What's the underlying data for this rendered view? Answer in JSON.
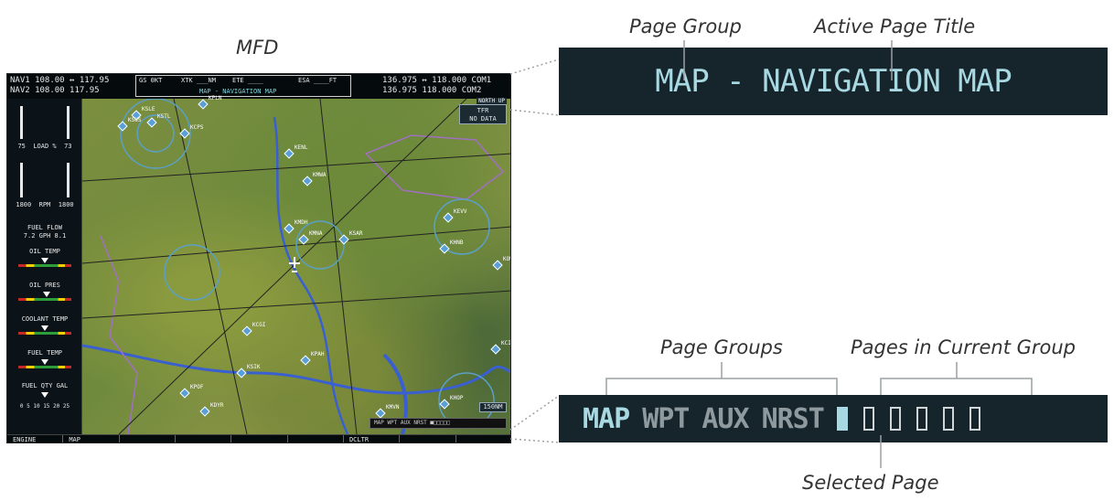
{
  "captions": {
    "mfd": "MFD",
    "page_group": "Page Group",
    "active_page_title": "Active Page Title",
    "page_groups": "Page Groups",
    "pages_in_group": "Pages in Current Group",
    "selected_page": "Selected Page"
  },
  "mfd": {
    "nav1": "NAV1 108.00 ↔ 117.95",
    "nav2": "NAV2 108.00    117.95",
    "gs": "GS  0KT",
    "xtk": "XTK ___NM",
    "ete": "ETE ____",
    "esa": "ESA ____FT",
    "com1": "136.975 ↔ 118.000 COM1",
    "com2": "136.975    118.000 COM2",
    "page_title": "MAP - NAVIGATION MAP",
    "orientation": "NORTH UP",
    "tfr_line1": "TFR",
    "tfr_line2": "NO DATA",
    "range": "150NM",
    "mini_nav": "MAP WPT AUX NRST ■□□□□□",
    "softkeys": [
      "ENGINE",
      "MAP",
      "",
      "",
      "",
      "",
      "DCLTR",
      "",
      ""
    ],
    "eis": {
      "load_left": "75",
      "load_label": "LOAD %",
      "load_right": "73",
      "rpm_left": "1800",
      "rpm_label": "RPM",
      "rpm_right": "1800",
      "fuel_flow_label": "FUEL FLOW",
      "fuel_flow_left": "7.2",
      "fuel_flow_unit": "GPH",
      "fuel_flow_right": "8.1",
      "gauges": [
        "OIL TEMP",
        "OIL PRES",
        "COOLANT TEMP",
        "FUEL TEMP",
        "FUEL QTY GAL"
      ],
      "fuel_qty_scale": "0  5  10 15  20  25"
    },
    "airports": [
      "KPLN",
      "KSLE",
      "KSUS",
      "KCPS",
      "KSTL",
      "KENL",
      "KMWA",
      "KMDH",
      "KMNA",
      "KSAR",
      "KEVV",
      "KHNB",
      "KOWB",
      "KCGI",
      "KPAH",
      "KSIK",
      "KPOF",
      "KDYR",
      "KHOP",
      "KMVN",
      "KCIR"
    ]
  },
  "zoom_title": {
    "text": "MAP - NAVIGATION MAP"
  },
  "zoom_nav": {
    "groups": [
      {
        "label": "MAP",
        "color": "#a8d8e2"
      },
      {
        "label": "WPT",
        "color": "#8f9a9e"
      },
      {
        "label": "AUX",
        "color": "#8f9a9e"
      },
      {
        "label": "NRST",
        "color": "#8f9a9e"
      }
    ],
    "pages_total": 6,
    "selected_index": 0
  }
}
